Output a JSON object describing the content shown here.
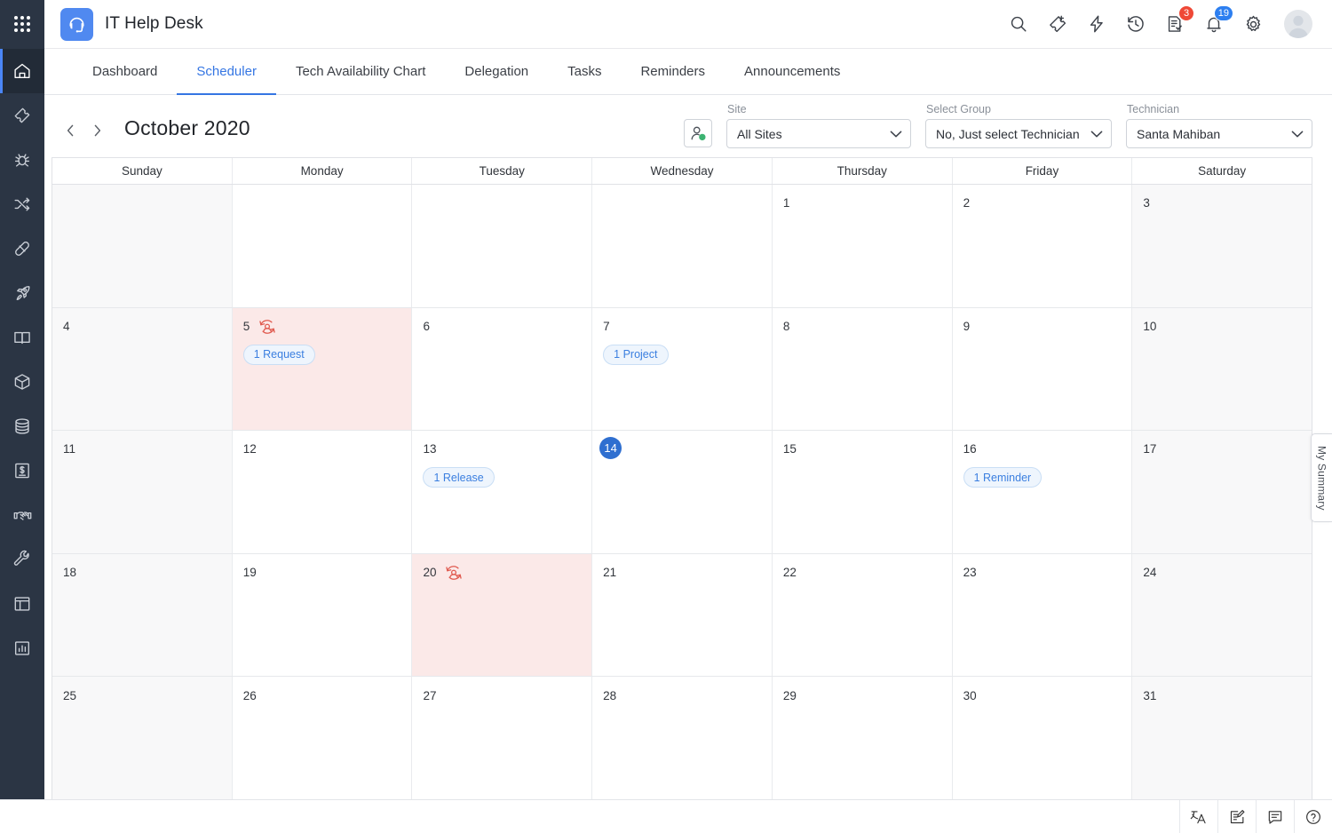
{
  "app": {
    "name": "IT Help Desk",
    "logo_icon": "headset-icon",
    "launcher_icon": "app-grid-icon"
  },
  "topbar": {
    "icons": [
      {
        "name": "search-icon",
        "label": "Search"
      },
      {
        "name": "add-ticket-icon",
        "label": "New Ticket"
      },
      {
        "name": "quick-actions-icon",
        "label": "Quick Actions"
      },
      {
        "name": "history-icon",
        "label": "Recent Items"
      },
      {
        "name": "approvals-icon",
        "label": "Approvals",
        "badge": "3",
        "badge_color": "#ef4836"
      },
      {
        "name": "notifications-bell-icon",
        "label": "Notifications",
        "badge": "19",
        "badge_color": "#2d7ff0"
      },
      {
        "name": "settings-gear-icon",
        "label": "Settings"
      }
    ],
    "avatar": "user-avatar"
  },
  "sidebar": {
    "items": [
      {
        "name": "sidebar-item-home",
        "icon": "home-icon",
        "active": true
      },
      {
        "name": "sidebar-item-requests",
        "icon": "ticket-icon",
        "active": false
      },
      {
        "name": "sidebar-item-problems",
        "icon": "bug-icon",
        "active": false
      },
      {
        "name": "sidebar-item-changes",
        "icon": "shuffle-icon",
        "active": false
      },
      {
        "name": "sidebar-item-incidents",
        "icon": "bandage-icon",
        "active": false
      },
      {
        "name": "sidebar-item-releases",
        "icon": "rocket-icon",
        "active": false
      },
      {
        "name": "sidebar-item-solutions",
        "icon": "book-icon",
        "active": false
      },
      {
        "name": "sidebar-item-assets",
        "icon": "box-icon",
        "active": false
      },
      {
        "name": "sidebar-item-cmdb",
        "icon": "database-icon",
        "active": false
      },
      {
        "name": "sidebar-item-purchase",
        "icon": "money-document-icon",
        "active": false
      },
      {
        "name": "sidebar-item-contracts",
        "icon": "handshake-icon",
        "active": false
      },
      {
        "name": "sidebar-item-setup",
        "icon": "wrench-icon",
        "active": false
      },
      {
        "name": "sidebar-item-dashboards",
        "icon": "layout-icon",
        "active": false
      },
      {
        "name": "sidebar-item-reports",
        "icon": "bar-chart-icon",
        "active": false
      }
    ]
  },
  "tabs": [
    {
      "label": "Dashboard",
      "active": false
    },
    {
      "label": "Scheduler",
      "active": true
    },
    {
      "label": "Tech Availability Chart",
      "active": false
    },
    {
      "label": "Delegation",
      "active": false
    },
    {
      "label": "Tasks",
      "active": false
    },
    {
      "label": "Reminders",
      "active": false
    },
    {
      "label": "Announcements",
      "active": false
    }
  ],
  "toolbar": {
    "prev_icon": "chevron-left-icon",
    "next_icon": "chevron-right-icon",
    "month_title": "October 2020",
    "tech_availability_icon": "technician-status-icon"
  },
  "filters": [
    {
      "name": "site",
      "label": "Site",
      "value": "All Sites",
      "options": [
        "All Sites"
      ]
    },
    {
      "name": "select-group",
      "label": "Select Group",
      "value": "No, Just select Technician",
      "options": [
        "No, Just select Technician"
      ]
    },
    {
      "name": "technician",
      "label": "Technician",
      "value": "Santa Mahiban",
      "options": [
        "Santa Mahiban"
      ]
    }
  ],
  "calendar": {
    "weekday_headers": [
      "Sunday",
      "Monday",
      "Tuesday",
      "Wednesday",
      "Thursday",
      "Friday",
      "Saturday"
    ],
    "leave_icon": "on-leave-icon",
    "leave_color": "#fbe9e8",
    "today_color": "#2f6fd0",
    "chip_color": "#3b7fe0",
    "weeks": [
      [
        {
          "day": "",
          "weekend": true
        },
        {
          "day": ""
        },
        {
          "day": ""
        },
        {
          "day": ""
        },
        {
          "day": "1"
        },
        {
          "day": "2"
        },
        {
          "day": "3",
          "weekend": true
        }
      ],
      [
        {
          "day": "4",
          "weekend": true
        },
        {
          "day": "5",
          "leave": true,
          "chip": "1 Request"
        },
        {
          "day": "6"
        },
        {
          "day": "7",
          "chip": "1 Project"
        },
        {
          "day": "8"
        },
        {
          "day": "9"
        },
        {
          "day": "10",
          "weekend": true
        }
      ],
      [
        {
          "day": "11",
          "weekend": true
        },
        {
          "day": "12"
        },
        {
          "day": "13",
          "chip": "1 Release"
        },
        {
          "day": "14",
          "today": true
        },
        {
          "day": "15"
        },
        {
          "day": "16",
          "chip": "1 Reminder"
        },
        {
          "day": "17",
          "weekend": true
        }
      ],
      [
        {
          "day": "18",
          "weekend": true
        },
        {
          "day": "19"
        },
        {
          "day": "20",
          "leave": true
        },
        {
          "day": "21"
        },
        {
          "day": "22"
        },
        {
          "day": "23"
        },
        {
          "day": "24",
          "weekend": true
        }
      ],
      [
        {
          "day": "25",
          "weekend": true
        },
        {
          "day": "26"
        },
        {
          "day": "27"
        },
        {
          "day": "28"
        },
        {
          "day": "29"
        },
        {
          "day": "30"
        },
        {
          "day": "31",
          "weekend": true
        }
      ]
    ]
  },
  "my_summary": {
    "label": "My Summary"
  },
  "bottombar": {
    "icons": [
      {
        "name": "language-icon"
      },
      {
        "name": "notes-edit-icon"
      },
      {
        "name": "chat-icon"
      },
      {
        "name": "help-icon"
      }
    ]
  }
}
